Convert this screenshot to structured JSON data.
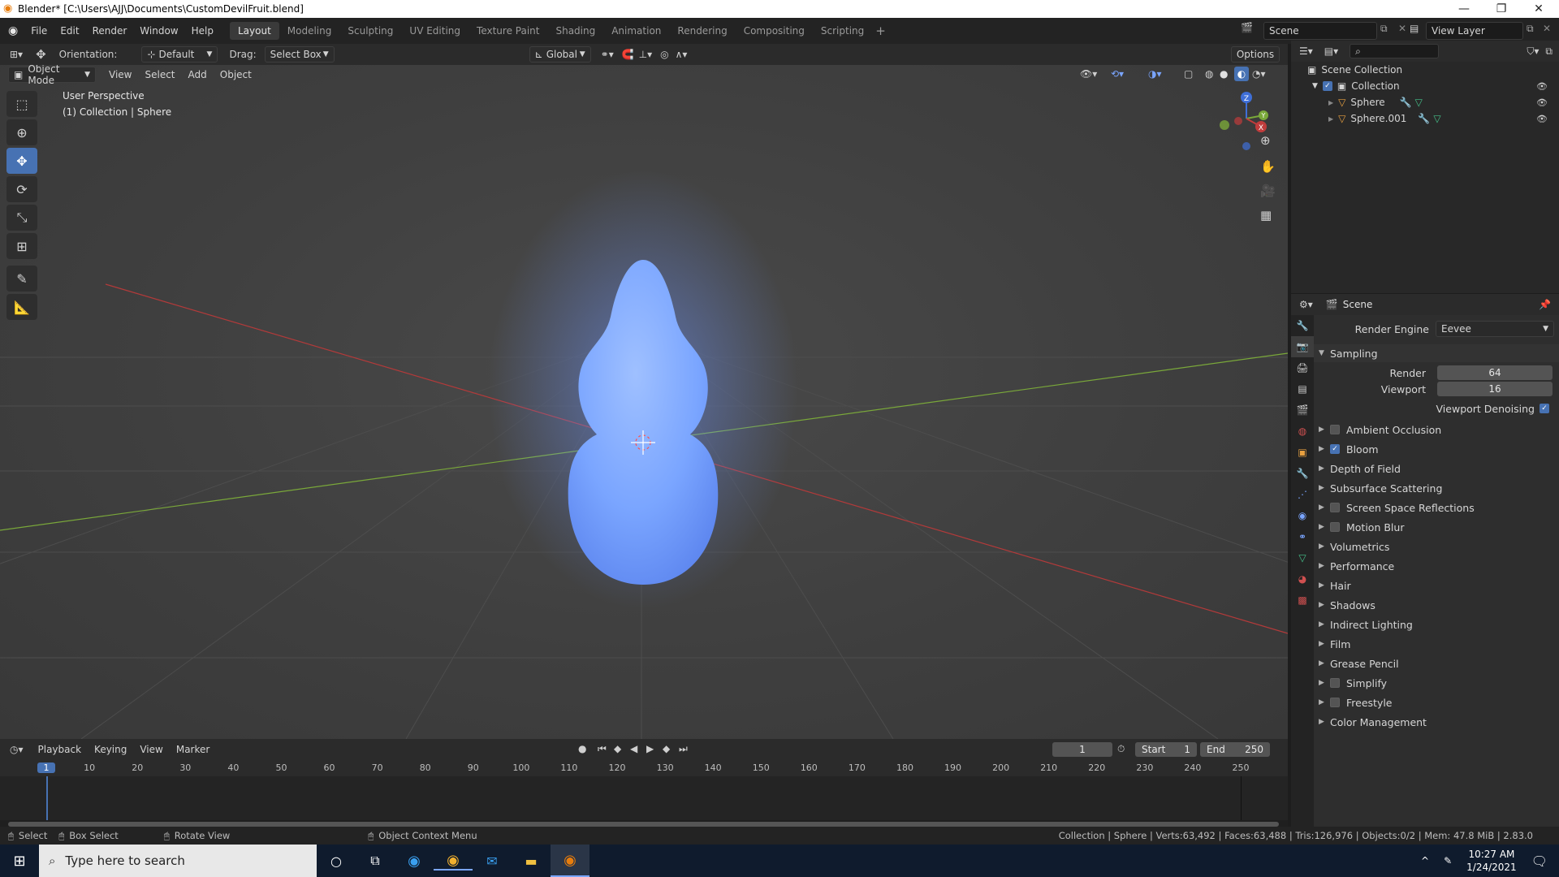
{
  "window": {
    "title": "Blender* [C:\\Users\\AJJ\\Documents\\CustomDevilFruit.blend]",
    "controls": [
      "—",
      "❐",
      "✕"
    ]
  },
  "menu": [
    "File",
    "Edit",
    "Render",
    "Window",
    "Help"
  ],
  "workspaces": [
    "Layout",
    "Modeling",
    "Sculpting",
    "UV Editing",
    "Texture Paint",
    "Shading",
    "Animation",
    "Rendering",
    "Compositing",
    "Scripting"
  ],
  "scene_field": "Scene",
  "view_layer_field": "View Layer",
  "tool_header": {
    "orientation_label": "Orientation:",
    "orientation_value": "Default",
    "drag_label": "Drag:",
    "drag_value": "Select Box",
    "transform_space": "Global",
    "options_label": "Options"
  },
  "viewport_header": {
    "mode": "Object Mode",
    "menus": [
      "View",
      "Select",
      "Add",
      "Object"
    ]
  },
  "viewport_overlay": {
    "line1": "User Perspective",
    "line2": "(1) Collection | Sphere"
  },
  "gizmo": {
    "z": "Z",
    "y": "Y",
    "x": "X"
  },
  "outliner": {
    "root": "Scene Collection",
    "collection": "Collection",
    "objects": [
      "Sphere",
      "Sphere.001"
    ]
  },
  "properties": {
    "context": "Scene",
    "render_engine_label": "Render Engine",
    "render_engine_value": "Eevee",
    "sampling_label": "Sampling",
    "render_label": "Render",
    "render_value": "64",
    "viewport_label": "Viewport",
    "viewport_value": "16",
    "denoise_label": "Viewport Denoising",
    "panels": [
      {
        "label": "Ambient Occlusion",
        "checkbox": true,
        "checked": false
      },
      {
        "label": "Bloom",
        "checkbox": true,
        "checked": true
      },
      {
        "label": "Depth of Field",
        "checkbox": false,
        "checked": false
      },
      {
        "label": "Subsurface Scattering",
        "checkbox": false,
        "checked": false
      },
      {
        "label": "Screen Space Reflections",
        "checkbox": true,
        "checked": false
      },
      {
        "label": "Motion Blur",
        "checkbox": true,
        "checked": false
      },
      {
        "label": "Volumetrics",
        "checkbox": false,
        "checked": false
      },
      {
        "label": "Performance",
        "checkbox": false,
        "checked": false
      },
      {
        "label": "Hair",
        "checkbox": false,
        "checked": false
      },
      {
        "label": "Shadows",
        "checkbox": false,
        "checked": false
      },
      {
        "label": "Indirect Lighting",
        "checkbox": false,
        "checked": false
      },
      {
        "label": "Film",
        "checkbox": false,
        "checked": false
      },
      {
        "label": "Grease Pencil",
        "checkbox": false,
        "checked": false
      },
      {
        "label": "Simplify",
        "checkbox": true,
        "checked": false
      },
      {
        "label": "Freestyle",
        "checkbox": true,
        "checked": false
      },
      {
        "label": "Color Management",
        "checkbox": false,
        "checked": false
      }
    ]
  },
  "timeline": {
    "menus": [
      "Playback",
      "Keying",
      "View",
      "Marker"
    ],
    "current_frame": "1",
    "start_label": "Start",
    "start_value": "1",
    "end_label": "End",
    "end_value": "250",
    "ruler": [
      "1",
      "10",
      "20",
      "30",
      "40",
      "50",
      "60",
      "70",
      "80",
      "90",
      "100",
      "110",
      "120",
      "130",
      "140",
      "150",
      "160",
      "170",
      "180",
      "190",
      "200",
      "210",
      "220",
      "230",
      "240",
      "250"
    ]
  },
  "statusbar": {
    "select": "Select",
    "box_select": "Box Select",
    "rotate_view": "Rotate View",
    "context_menu": "Object Context Menu",
    "stats": "Collection | Sphere | Verts:63,492 | Faces:63,488 | Tris:126,976 | Objects:0/2 | Mem: 47.8 MiB | 2.83.0"
  },
  "taskbar": {
    "search_placeholder": "Type here to search",
    "time": "10:27 AM",
    "date": "1/24/2021"
  },
  "colors": {
    "accent": "#4772b3",
    "fruit": "#7fa8ff",
    "x_axis": "#c03c3c",
    "y_axis": "#7aa83a"
  }
}
